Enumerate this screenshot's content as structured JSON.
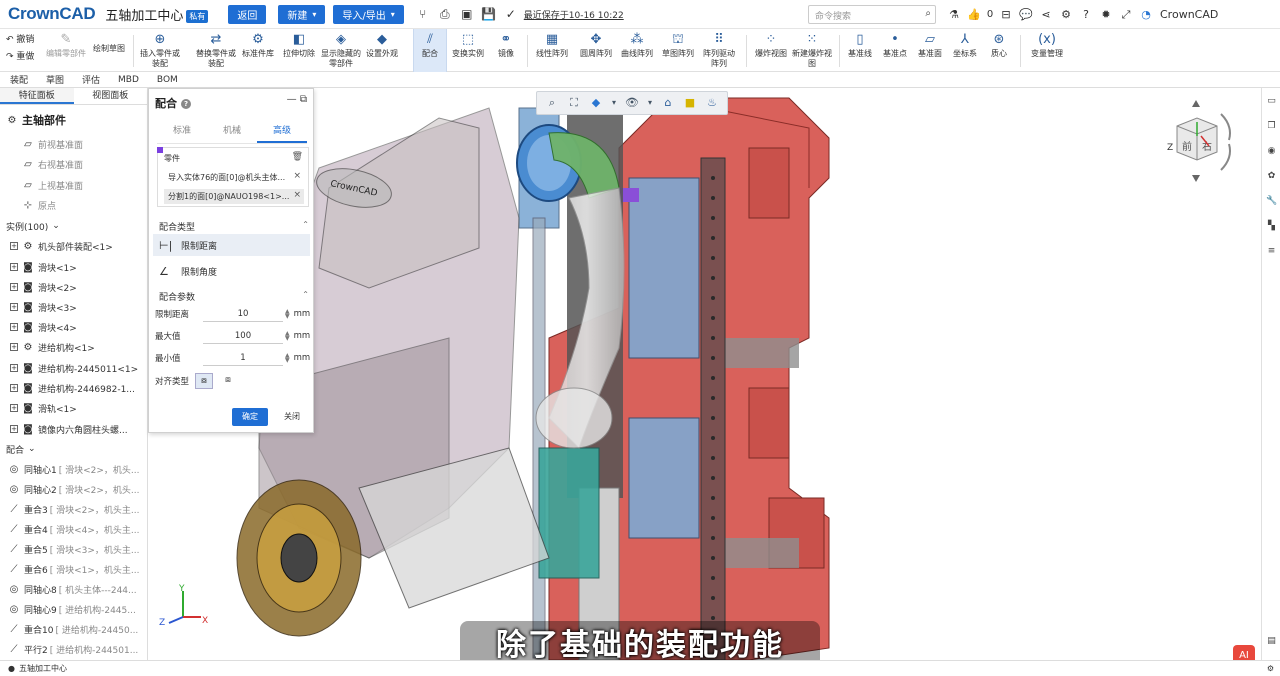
{
  "app": {
    "logo": "CrownCAD",
    "doc_title": "五轴加工中心",
    "private_badge": "私有",
    "back_btn": "返回",
    "new_btn": "新建",
    "import_btn": "导入/导出",
    "save_status": "最近保存于10-16 10:22",
    "search_placeholder": "命令搜索",
    "like_count": "0",
    "brand_name": "CrownCAD"
  },
  "ribbon": {
    "undo": "撤销",
    "redo": "重做",
    "items": [
      {
        "label": "编辑零部件",
        "icon": "edit-part-icon"
      },
      {
        "label": "绘制草图",
        "icon": "sketch-icon"
      },
      {
        "label": "插入零件或装配",
        "icon": "insert-part-icon"
      },
      {
        "label": "替换零件或装配",
        "icon": "replace-part-icon"
      },
      {
        "label": "标准件库",
        "icon": "standard-lib-icon"
      },
      {
        "label": "拉伸切除",
        "icon": "extrude-cut-icon"
      },
      {
        "label": "显示隐藏的零部件",
        "icon": "show-hide-icon"
      },
      {
        "label": "设置外观",
        "icon": "appearance-icon"
      },
      {
        "label": "配合",
        "icon": "mate-icon"
      },
      {
        "label": "变换实例",
        "icon": "transform-icon"
      },
      {
        "label": "镜像",
        "icon": "mirror-icon"
      },
      {
        "label": "线性阵列",
        "icon": "linear-pattern-icon"
      },
      {
        "label": "圆周阵列",
        "icon": "circular-pattern-icon"
      },
      {
        "label": "曲线阵列",
        "icon": "curve-pattern-icon"
      },
      {
        "label": "草图阵列",
        "icon": "sketch-pattern-icon"
      },
      {
        "label": "阵列驱动阵列",
        "icon": "pattern-driven-icon"
      },
      {
        "label": "爆炸视图",
        "icon": "explode-icon"
      },
      {
        "label": "新建爆炸视图",
        "icon": "new-explode-icon"
      },
      {
        "label": "基准线",
        "icon": "datum-line-icon"
      },
      {
        "label": "基准点",
        "icon": "datum-point-icon"
      },
      {
        "label": "基准面",
        "icon": "datum-plane-icon"
      },
      {
        "label": "坐标系",
        "icon": "coord-system-icon"
      },
      {
        "label": "质心",
        "icon": "centroid-icon"
      },
      {
        "label": "变量管理",
        "icon": "variable-icon"
      }
    ]
  },
  "subtabs": [
    "装配",
    "草图",
    "评估",
    "MBD",
    "BOM"
  ],
  "left_panel": {
    "tabs": [
      "特征面板",
      "视图面板"
    ],
    "root": "主轴部件",
    "planes": [
      "前视基准面",
      "右视基准面",
      "上视基准面",
      "原点"
    ],
    "instances_header": "实例(100)",
    "instances": [
      "机头部件装配<1>",
      "滑块<1>",
      "滑块<2>",
      "滑块<3>",
      "滑块<4>",
      "进给机构<1>",
      "进给机构-2445011<1>",
      "进给机构-2446982-1...",
      "滑轨<1>",
      "镜像内六角圆柱头螺..."
    ],
    "mates_header": "配合",
    "mates": [
      {
        "name": "同轴心1",
        "detail": "[ 滑块<2>，机头..."
      },
      {
        "name": "同轴心2",
        "detail": "[ 滑块<2>，机头..."
      },
      {
        "name": "重合3",
        "detail": "[ 滑块<2>，机头主..."
      },
      {
        "name": "重合4",
        "detail": "[ 滑块<4>，机头主..."
      },
      {
        "name": "重合5",
        "detail": "[ 滑块<3>，机头主..."
      },
      {
        "name": "重合6",
        "detail": "[ 滑块<1>，机头主..."
      },
      {
        "name": "同轴心8",
        "detail": "[ 机头主体---244..."
      },
      {
        "name": "同轴心9",
        "detail": "[ 进给机构-2445..."
      },
      {
        "name": "重合10",
        "detail": "[ 进给机构-24450..."
      },
      {
        "name": "平行2",
        "detail": "[ 进给机构-244501..."
      }
    ]
  },
  "dialog": {
    "title": "配合",
    "tabs": [
      "标准",
      "机械",
      "高级"
    ],
    "parts_label": "零件",
    "selections": [
      "导入实体76的面[0]@机头主体...",
      "分割1的面[0]@NAUO198<1>..."
    ],
    "mate_type_label": "配合类型",
    "mate_types": [
      "限制距离",
      "限制角度"
    ],
    "params_label": "配合参数",
    "params": [
      {
        "label": "限制距离",
        "value": "10",
        "unit": "mm"
      },
      {
        "label": "最大值",
        "value": "100",
        "unit": "mm"
      },
      {
        "label": "最小值",
        "value": "1",
        "unit": "mm"
      }
    ],
    "align_label": "对齐类型",
    "ok": "确定",
    "close": "关闭"
  },
  "viewport": {
    "subtitle": "除了基础的装配功能",
    "axis": {
      "x": "X",
      "y": "Y",
      "z": "Z"
    },
    "viewcube": {
      "front": "前",
      "right": "右",
      "z": "Z"
    },
    "logo_stamp": "CrownCAD"
  },
  "status": {
    "doc": "五轴加工中心"
  },
  "colors": {
    "accent": "#1f6ed4",
    "part_red": "#d9605a",
    "part_blue": "#6f9fcf",
    "part_green": "#6fb36a"
  }
}
